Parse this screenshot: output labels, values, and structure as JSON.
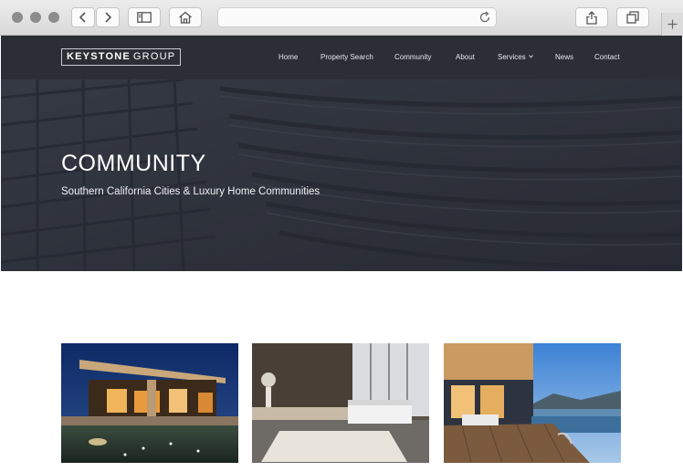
{
  "browser": {
    "back_icon": "chevron-left-icon",
    "forward_icon": "chevron-right-icon",
    "sidebar_icon": "sidebar-icon",
    "home_icon": "home-icon",
    "reload_icon": "reload-icon",
    "share_icon": "share-icon",
    "tabs_icon": "tabs-icon",
    "new_tab_icon": "plus-icon",
    "address": ""
  },
  "site": {
    "logo_bold": "KEYSTONE",
    "logo_light": "GROUP",
    "nav": [
      {
        "label": "Home"
      },
      {
        "label": "Property Search"
      },
      {
        "label": "Community"
      },
      {
        "label": "About"
      },
      {
        "label": "Services"
      },
      {
        "label": "News"
      },
      {
        "label": "Contact"
      }
    ],
    "header_color": "#2b2e35"
  },
  "hero": {
    "title": "COMMUNITY",
    "subtitle": "Southern California Cities & Luxury Home Communities"
  },
  "cards": [
    {
      "image": "modern-house-pool-night"
    },
    {
      "image": "modern-bedroom-interior"
    },
    {
      "image": "infinity-pool-lake-view"
    }
  ]
}
